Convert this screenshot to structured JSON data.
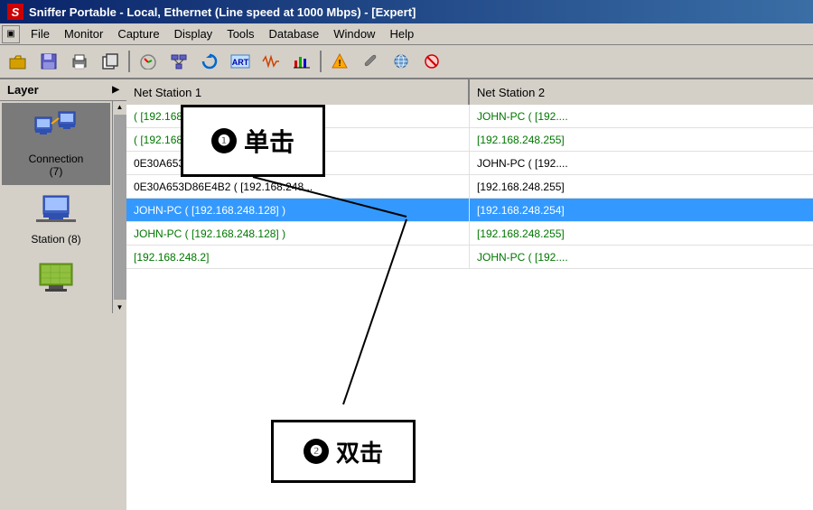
{
  "titlebar": {
    "icon": "S",
    "title": "Sniffer Portable - Local, Ethernet (Line speed at 1000 Mbps) - [Expert]"
  },
  "menubar": {
    "icon_label": "▣",
    "items": [
      "File",
      "Monitor",
      "Capture",
      "Display",
      "Tools",
      "Database",
      "Window",
      "Help"
    ]
  },
  "toolbar": {
    "buttons": [
      "📂",
      "💾",
      "🖨",
      "📋",
      "📊",
      "📡",
      "🔄",
      "🎨",
      "📈",
      "🌐",
      "⚡",
      "⚠",
      "🔧",
      "🌍",
      "🚫"
    ]
  },
  "sidebar": {
    "header": "Layer",
    "items": [
      {
        "label": "Connection\n(7)",
        "icon": "connection"
      },
      {
        "label": "Station (8)",
        "icon": "station"
      },
      {
        "label": "",
        "icon": "network"
      }
    ]
  },
  "table": {
    "columns": [
      "Net Station 1",
      "Net Station 2"
    ],
    "rows": [
      {
        "col1": "( [192.168.248...",
        "col2": "JOHN-PC ( [192....",
        "selected": false,
        "green": true
      },
      {
        "col1": "( [192.168.248...",
        "col2": "[192.168.248.255]",
        "selected": false,
        "green": true
      },
      {
        "col1": "0E30A653D86E4B2 ( [192.168.248...",
        "col2": "JOHN-PC ( [192....",
        "selected": false,
        "green": false
      },
      {
        "col1": "0E30A653D86E4B2 ( [192.168.248...",
        "col2": "[192.168.248.255]",
        "selected": false,
        "green": false
      },
      {
        "col1": "JOHN-PC ( [192.168.248.128] )",
        "col2": "[192.168.248.254]",
        "selected": true,
        "green": false
      },
      {
        "col1": "JOHN-PC ( [192.168.248.128] )",
        "col2": "[192.168.248.255]",
        "selected": false,
        "green": true
      },
      {
        "col1": "[192.168.248.2]",
        "col2": "JOHN-PC ( [192....",
        "selected": false,
        "green": true
      }
    ]
  },
  "callouts": {
    "callout1": {
      "number": "❶",
      "text": "单击"
    },
    "callout2": {
      "number": "❷",
      "text": "双击"
    }
  }
}
